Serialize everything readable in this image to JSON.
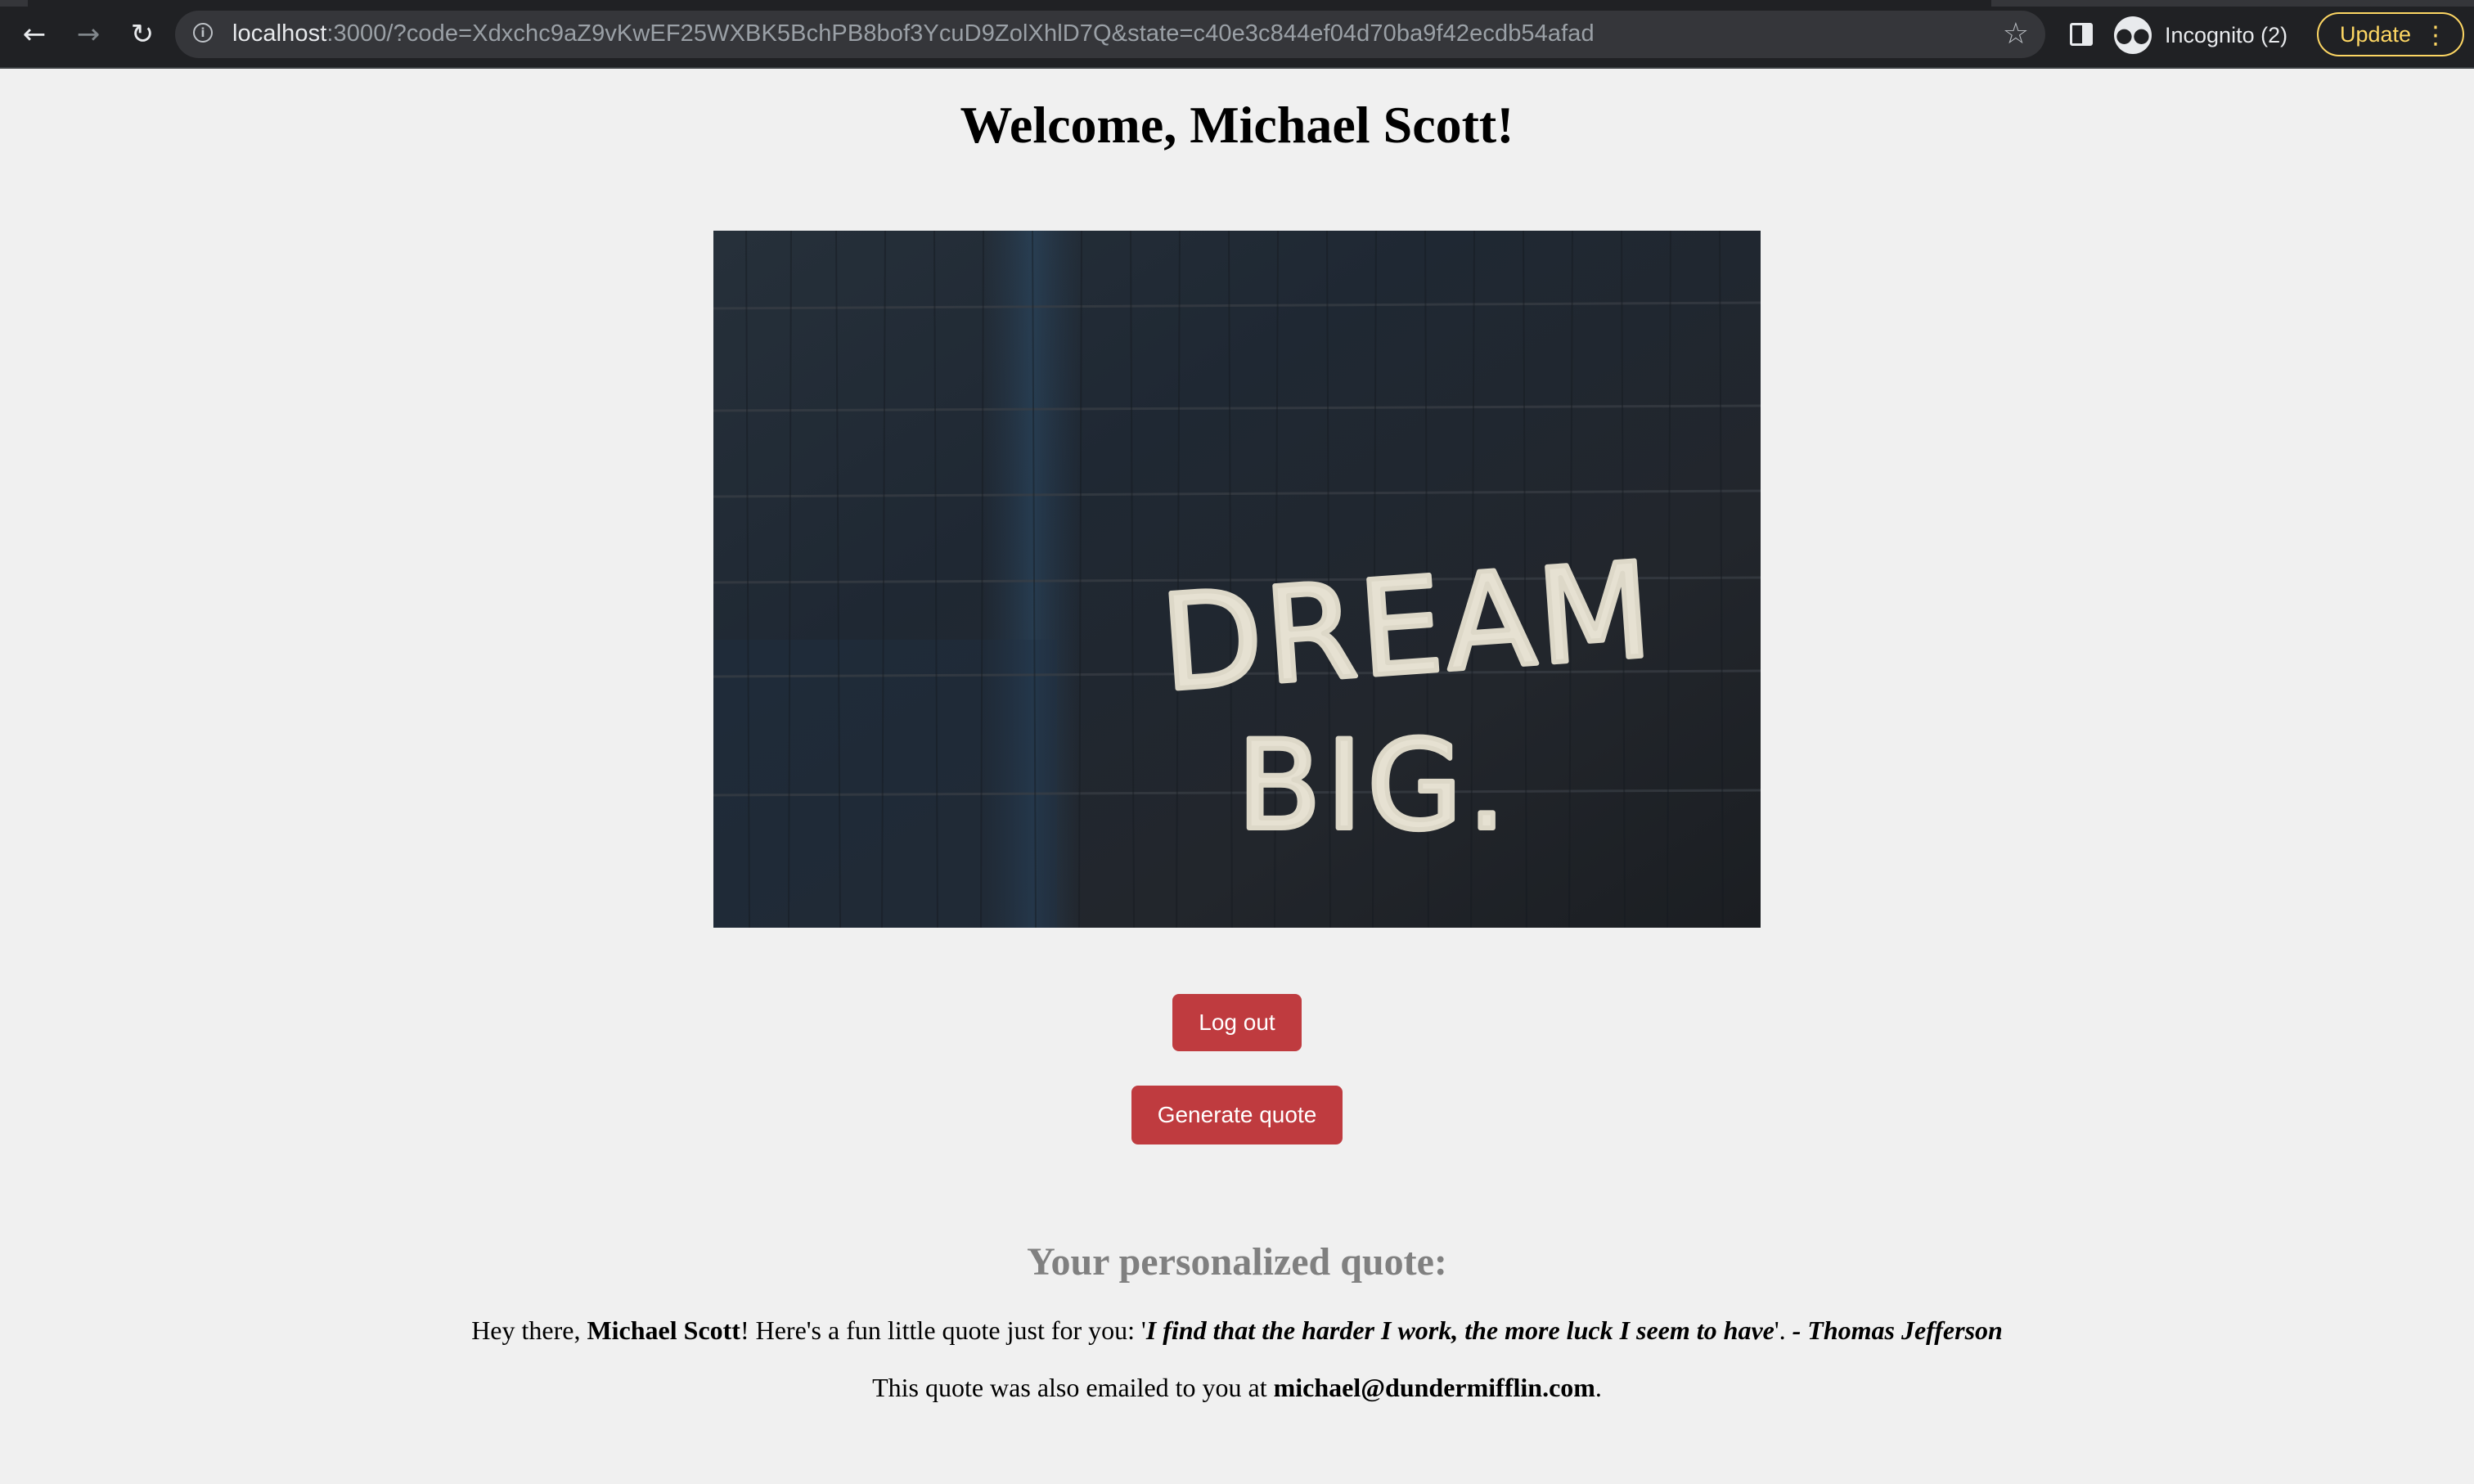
{
  "browser": {
    "url_host": "localhost",
    "url_rest": ":3000/?code=Xdxchc9aZ9vKwEF25WXBK5BchPB8bof3YcuD9ZolXhlD7Q&state=c40e3c844ef04d70ba9f42ecdb54afad",
    "profile_label": "Incognito (2)",
    "update_label": "Update",
    "icons": {
      "back": "back-arrow-icon",
      "forward": "forward-arrow-icon",
      "reload": "reload-icon",
      "info": "info-icon",
      "bookmark": "star-icon",
      "side_panel": "side-panel-icon",
      "profile": "incognito-icon",
      "menu": "more-vert-icon"
    },
    "accent_color": "#fdd663"
  },
  "page": {
    "title": "Welcome, Michael Scott!",
    "hero_image": {
      "line1": "DREAM",
      "line2": "BIG."
    },
    "buttons": {
      "logout": "Log out",
      "generate": "Generate quote"
    },
    "button_color": "#bf3b3f",
    "quote_heading": "Your personalized quote:",
    "quote": {
      "prefix": "Hey there, ",
      "name": "Michael Scott",
      "middle": "! Here's a fun little quote just for you: '",
      "text": "I find that the harder I work, the more luck I seem to have",
      "close": "'. ",
      "author": "- Thomas Jefferson"
    },
    "email_notice": {
      "prefix": "This quote was also emailed to you at ",
      "email": "michael@dundermifflin.com",
      "suffix": "."
    }
  }
}
